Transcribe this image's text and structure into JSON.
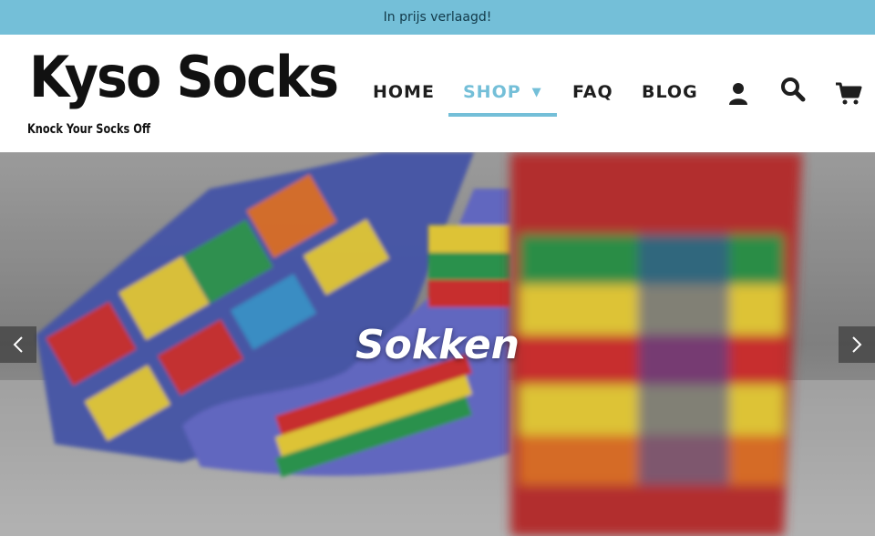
{
  "announcement": {
    "text": "In prijs verlaagd!"
  },
  "logo": {
    "name": "Kyso Socks",
    "tagline": "Knock Your Socks Off"
  },
  "nav": {
    "items": [
      {
        "label": "HOME"
      },
      {
        "label": "SHOP",
        "active": true,
        "has_dropdown": true
      },
      {
        "label": "FAQ"
      },
      {
        "label": "BLOG"
      }
    ],
    "icons": [
      "user-icon",
      "search-icon",
      "cart-icon"
    ],
    "dropdown_caret": "▼"
  },
  "hero": {
    "title": "Sokken",
    "prev_icon": "chevron-left-icon",
    "next_icon": "chevron-right-icon"
  },
  "colors": {
    "accent": "#74bfd8",
    "text": "#1e1e1e",
    "announcement_bg": "#74bfd8"
  }
}
